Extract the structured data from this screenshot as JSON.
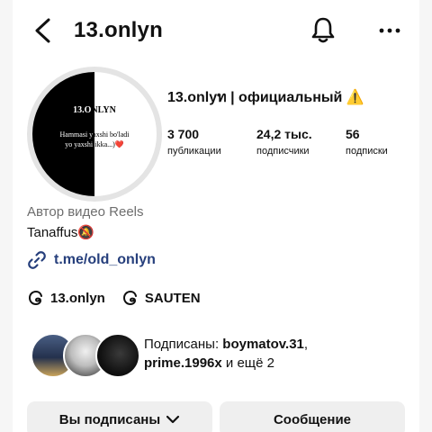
{
  "header": {
    "username": "13.onlyn",
    "icons": [
      "back-icon",
      "bell-icon",
      "more-icon"
    ]
  },
  "avatar": {
    "logo_text_white": "13.O",
    "logo_text_black": "NLYN",
    "caption_line1_white": "Hammasi y",
    "caption_line1_black": "axshi bo'ladi",
    "caption_line2_white": "yo yaxshi",
    "caption_line2_black": "likka...)",
    "heart": "❤️"
  },
  "profile": {
    "display_name": "13.onlyท | официальный ⚠️",
    "stats": [
      {
        "value": "3 700",
        "label": "публикации"
      },
      {
        "value": "24,2 тыс.",
        "label": "подписчики"
      },
      {
        "value": "56",
        "label": "подписки"
      }
    ],
    "category": "Автор видео Reels",
    "bio": "Tanaffus🔕",
    "link": "t.me/old_onlyn"
  },
  "threads": [
    {
      "label": "13.onlyn",
      "icon": "threads-icon"
    },
    {
      "label": "SAUTEN",
      "icon": "threads-icon"
    }
  ],
  "mutuals": {
    "prefix": "Подписаны: ",
    "user1": "boymatov.31",
    "separator": ",",
    "user2": "prime.1996x",
    "suffix": " и ещё 2"
  },
  "actions": {
    "following_label": "Вы подписаны",
    "message_label": "Сообщение"
  },
  "colors": {
    "link": "#263f7c",
    "button_bg": "#efefef",
    "secondary_text": "#6e6e6e"
  }
}
